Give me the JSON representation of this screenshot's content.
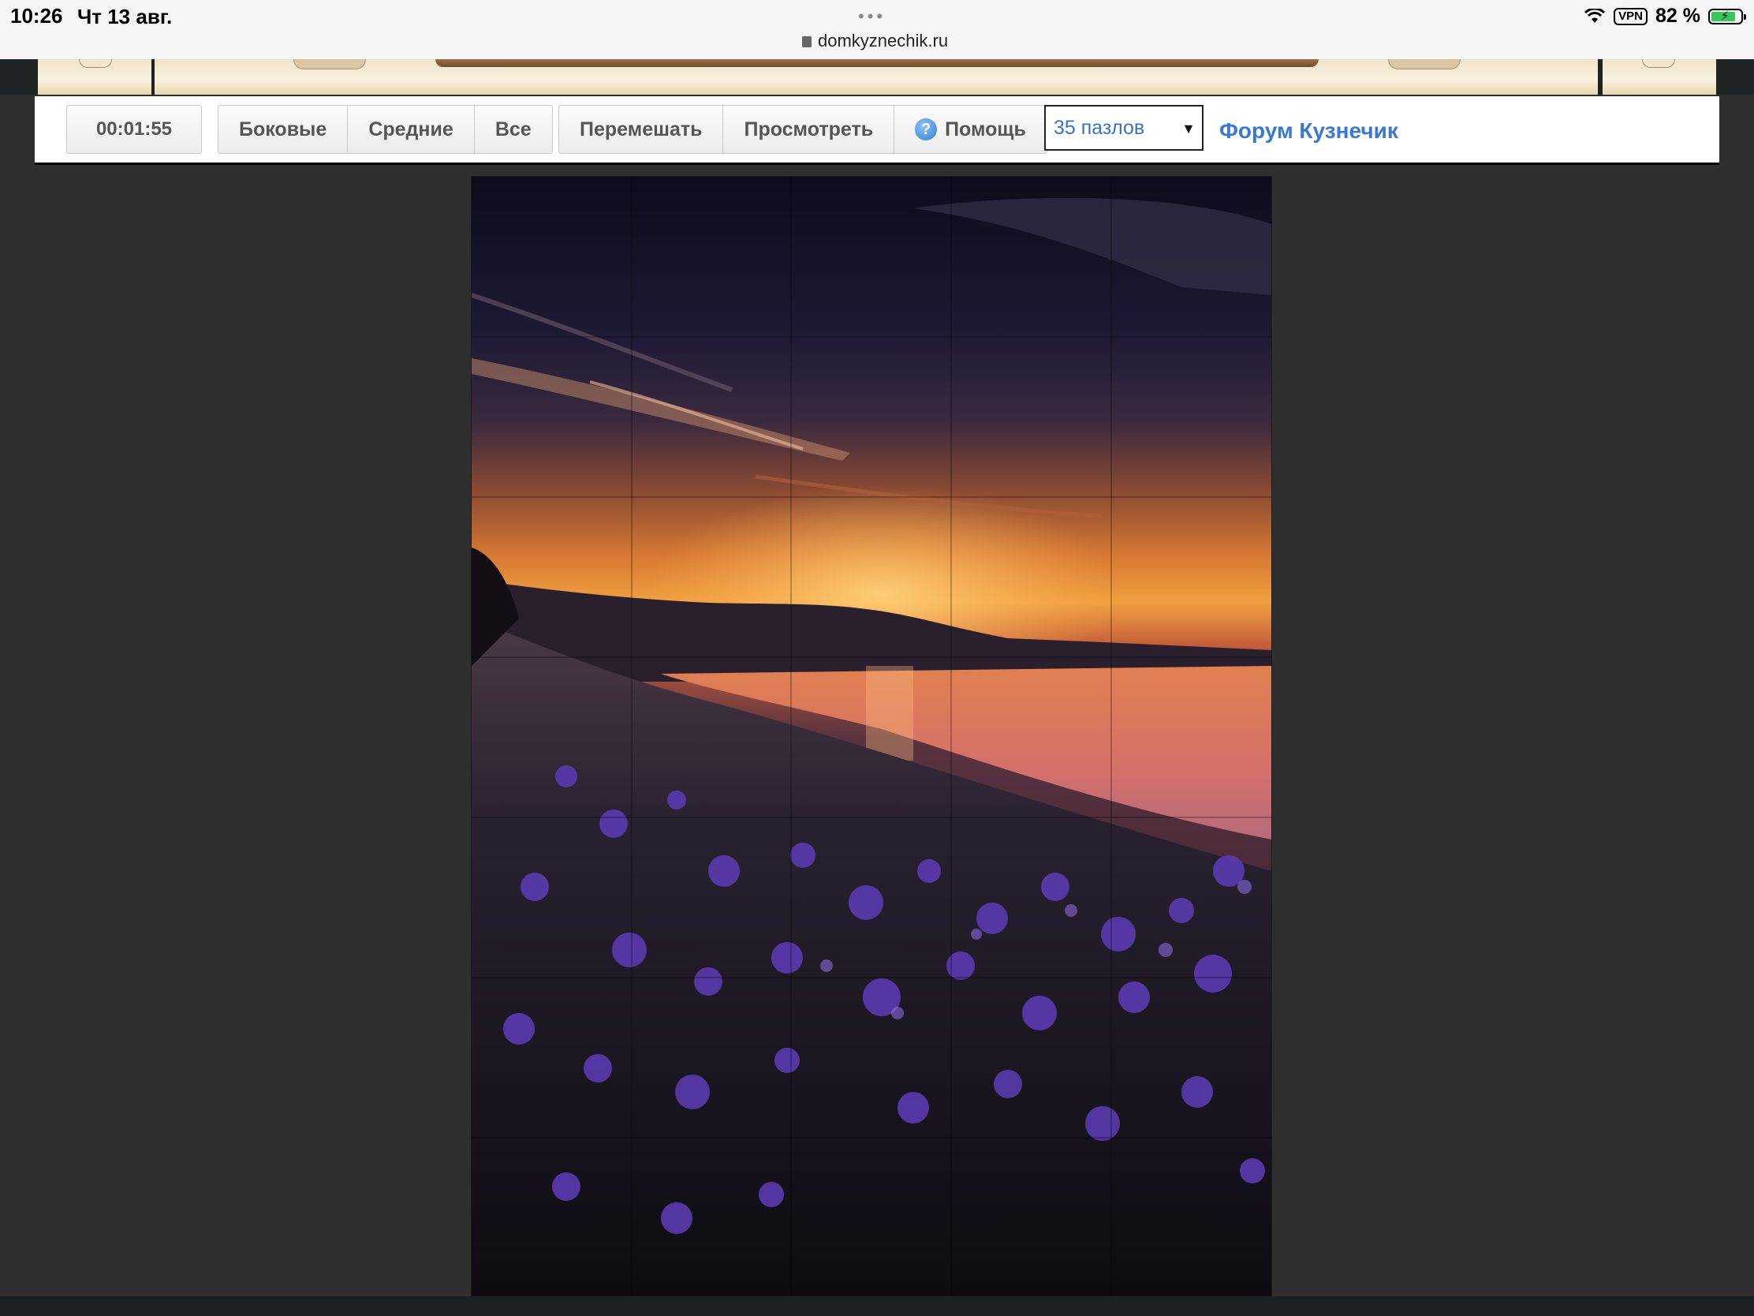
{
  "status_bar": {
    "time": "10:26",
    "date": "Чт 13 авг.",
    "url": "domkyznechik.ru",
    "vpn": "VPN",
    "battery": "82 %"
  },
  "toolbar": {
    "timer": "00:01:55",
    "pieces_buttons": [
      "Боковые",
      "Средние",
      "Все"
    ],
    "action_buttons": [
      "Перемешать",
      "Просмотреть",
      "Помощь"
    ],
    "pieces_select": "35 пазлов",
    "forum_link": "Форум Кузнечик"
  },
  "puzzle": {
    "image": "sunset over lake with purple flowers",
    "columns": 5,
    "rows": 7
  }
}
